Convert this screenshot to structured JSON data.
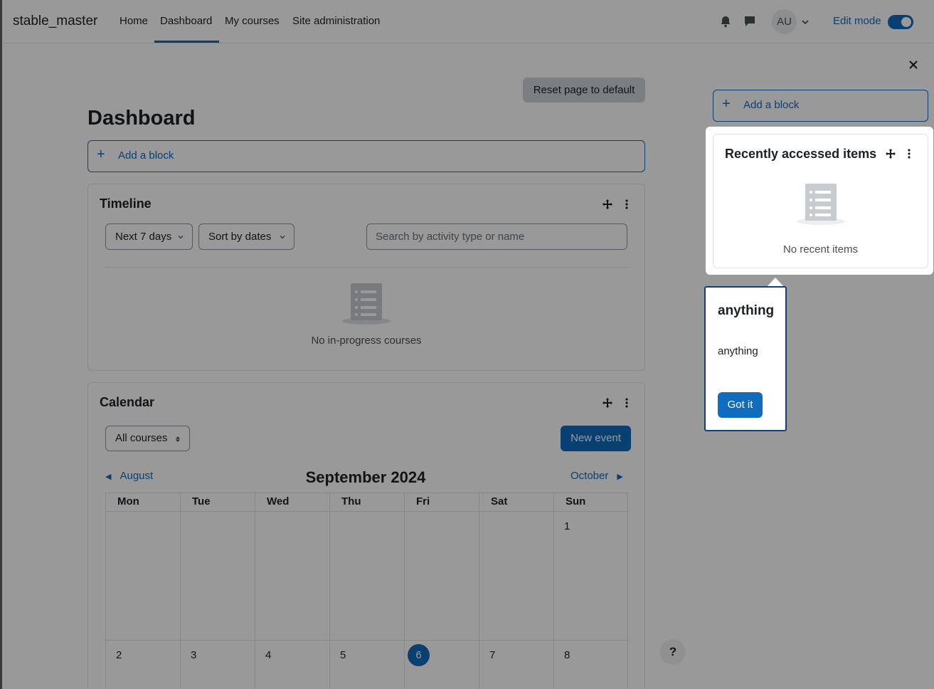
{
  "navbar": {
    "brand": "stable_master",
    "items": [
      "Home",
      "Dashboard",
      "My courses",
      "Site administration"
    ],
    "avatar_initials": "AU",
    "edit_mode_label": "Edit mode",
    "edit_mode_on": true
  },
  "main": {
    "reset_button": "Reset page to default",
    "title": "Dashboard",
    "add_block": "Add a block"
  },
  "timeline": {
    "title": "Timeline",
    "filter_days": "Next 7 days",
    "sort": "Sort by dates",
    "search_placeholder": "Search by activity type or name",
    "empty": "No in-progress courses"
  },
  "calendar": {
    "title": "Calendar",
    "course_filter": "All courses",
    "new_event": "New event",
    "prev_month": "August",
    "next_month": "October",
    "month_title": "September 2024",
    "weekdays": [
      "Mon",
      "Tue",
      "Wed",
      "Thu",
      "Fri",
      "Sat",
      "Sun"
    ],
    "row1": [
      "",
      "",
      "",
      "",
      "",
      "",
      "1"
    ],
    "row2": [
      "2",
      "3",
      "4",
      "5",
      "6",
      "7",
      "8"
    ],
    "today": "6"
  },
  "drawer": {
    "add_block": "Add a block",
    "recent_title": "Recently accessed items",
    "recent_empty": "No recent items"
  },
  "tour": {
    "title": "anything",
    "body": "anything",
    "button": "Got it"
  },
  "help_label": "?",
  "colors": {
    "primary": "#0f6cbf",
    "tour_border": "#0f3f73"
  }
}
